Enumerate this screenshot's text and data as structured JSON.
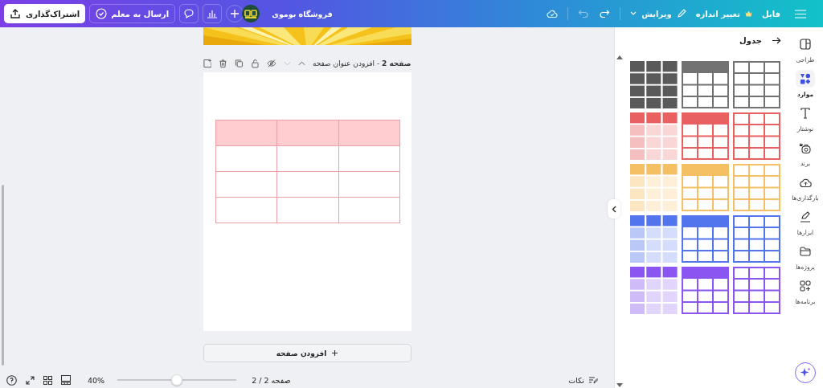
{
  "topbar": {
    "share_button": "اشتراک‌گذاری",
    "send_button": "ارسال به معلم",
    "store_name": "فروشگاه بوموی",
    "menu": [
      {
        "label": "فایل",
        "kind": "plain"
      },
      {
        "label": "تغییر اندازه",
        "kind": "premium"
      },
      {
        "label": "ویرایش",
        "kind": "edit"
      }
    ]
  },
  "canvas": {
    "page_header": "**صفحه 2** - افزودن عنوان صفحه",
    "add_page_button": "افزودن صفحه"
  },
  "footer": {
    "zoom": "40%",
    "zoom_slider": {
      "level": 0.5
    },
    "page_count": "صفحه 2 / 2",
    "notes": "نکات"
  },
  "panel": {
    "title": "جدول",
    "templates": [
      {
        "kind": "solid",
        "color": "#5a5a5a"
      },
      {
        "kind": "header",
        "color": "#727272"
      },
      {
        "kind": "outline",
        "color": "#727272"
      },
      {
        "kind": "tinted",
        "color": "#e86060"
      },
      {
        "kind": "header",
        "color": "#e86060"
      },
      {
        "kind": "outline",
        "color": "#e86060"
      },
      {
        "kind": "tinted",
        "color": "#f5c064"
      },
      {
        "kind": "header",
        "color": "#f5c064"
      },
      {
        "kind": "outline",
        "color": "#f5c064"
      },
      {
        "kind": "tinted",
        "color": "#5275ee"
      },
      {
        "kind": "header",
        "color": "#5275ee"
      },
      {
        "kind": "outline",
        "color": "#5275ee"
      },
      {
        "kind": "tinted",
        "color": "#8a55f0"
      },
      {
        "kind": "header",
        "color": "#8a55f0"
      },
      {
        "kind": "outline",
        "color": "#8a55f0"
      }
    ]
  },
  "rail": [
    {
      "label": "طراحی",
      "selected": false
    },
    {
      "label": "موارد",
      "selected": true
    },
    {
      "label": "نوشتار",
      "selected": false
    },
    {
      "label": "برند",
      "selected": false
    },
    {
      "label": "بارگذاری‌ها",
      "selected": false
    },
    {
      "label": "ابزارها",
      "selected": false
    },
    {
      "label": "پروژه‌ها",
      "selected": false
    },
    {
      "label": "برنامه‌ها",
      "selected": false
    }
  ]
}
